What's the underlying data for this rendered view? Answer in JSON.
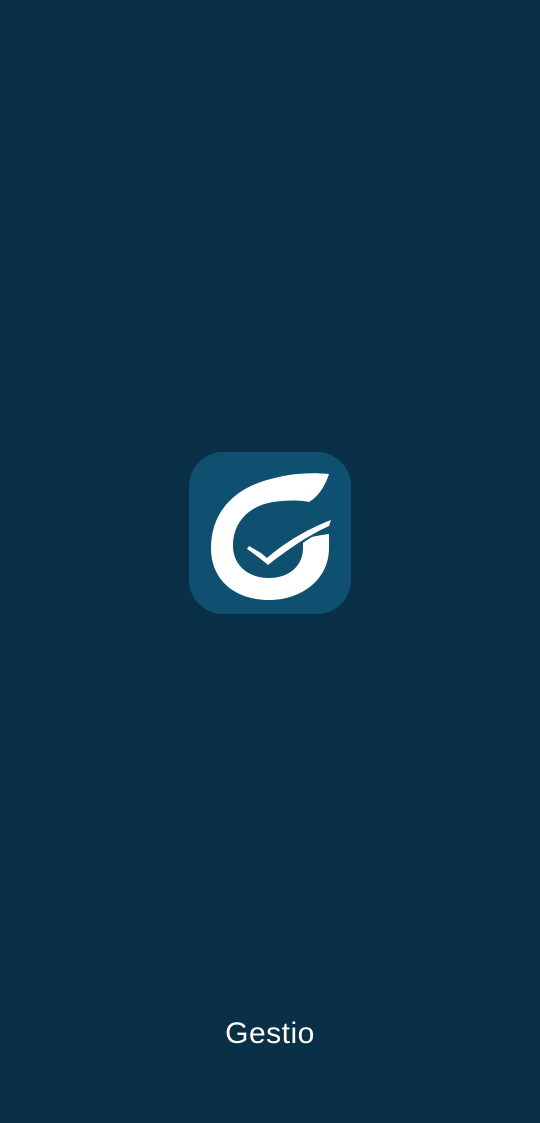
{
  "app": {
    "name": "Gestio",
    "logo_icon": "gestio-g-check-logo-icon"
  },
  "colors": {
    "background": "#093047",
    "logo_tile": "#0f5070",
    "logo_mark": "#ffffff",
    "text": "#ffffff"
  }
}
